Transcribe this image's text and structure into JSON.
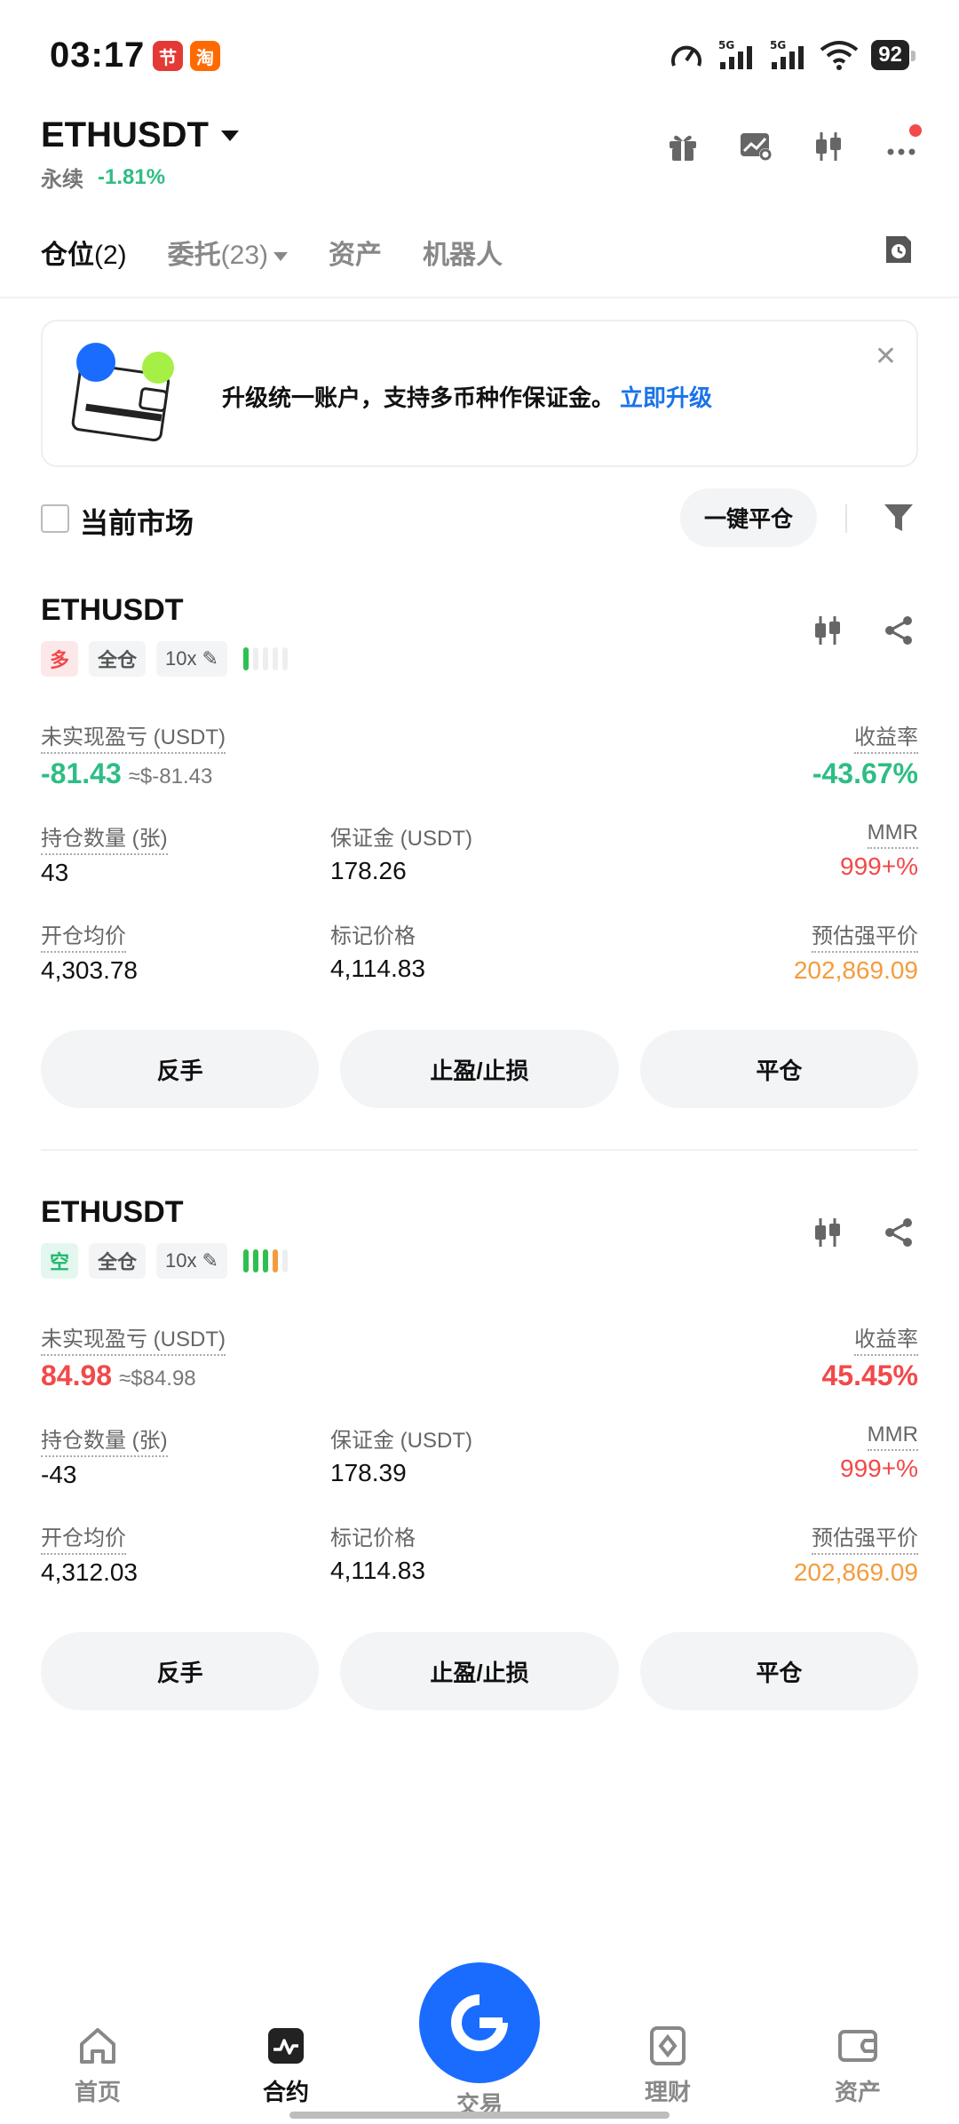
{
  "status_bar": {
    "time": "03:17",
    "badge_1": "节",
    "badge_2": "淘",
    "battery": "92"
  },
  "header": {
    "symbol": "ETHUSDT",
    "contract_type": "永续",
    "change": "-1.81%"
  },
  "tabs": [
    {
      "label": "仓位",
      "count": "(2)"
    },
    {
      "label": "委托",
      "count": "(23)"
    },
    {
      "label": "资产",
      "count": ""
    },
    {
      "label": "机器人",
      "count": ""
    }
  ],
  "banner": {
    "text": "升级统一账户，支持多币种作保证金。",
    "link": "立即升级"
  },
  "filter": {
    "current_market": "当前市场",
    "close_all": "一键平仓"
  },
  "labels": {
    "unrealized_pnl": "未实现盈亏",
    "unrealized_unit": "(USDT)",
    "roe": "收益率",
    "position_size": "持仓数量 (张)",
    "margin": "保证金",
    "margin_unit": "(USDT)",
    "mmr": "MMR",
    "entry_price": "开仓均价",
    "mark_price": "标记价格",
    "liq_price": "预估强平价",
    "reverse": "反手",
    "tp_sl": "止盈/止损",
    "close": "平仓"
  },
  "positions": [
    {
      "symbol": "ETHUSDT",
      "side": "多",
      "margin_mode": "全仓",
      "leverage": "10x",
      "risk_level": 1,
      "unrealized_pnl": "-81.43",
      "unrealized_pnl_usd": "≈$-81.43",
      "roe": "-43.67%",
      "size": "43",
      "margin": "178.26",
      "mmr": "999+%",
      "entry_price": "4,303.78",
      "mark_price": "4,114.83",
      "liq_price": "202,869.09"
    },
    {
      "symbol": "ETHUSDT",
      "side": "空",
      "margin_mode": "全仓",
      "leverage": "10x",
      "risk_level": 4,
      "unrealized_pnl": "84.98",
      "unrealized_pnl_usd": "≈$84.98",
      "roe": "45.45%",
      "size": "-43",
      "margin": "178.39",
      "mmr": "999+%",
      "entry_price": "4,312.03",
      "mark_price": "4,114.83",
      "liq_price": "202,869.09"
    }
  ],
  "bottom_nav": [
    {
      "label": "首页",
      "icon": "home-icon"
    },
    {
      "label": "合约",
      "icon": "futures-icon"
    },
    {
      "label": "交易",
      "icon": "trade-icon"
    },
    {
      "label": "理财",
      "icon": "earn-icon"
    },
    {
      "label": "资产",
      "icon": "wallet-icon"
    }
  ],
  "colors": {
    "up": "#f2494a",
    "down": "#2ebd85",
    "accent": "#1a6cff",
    "liq": "#f39c3d"
  }
}
